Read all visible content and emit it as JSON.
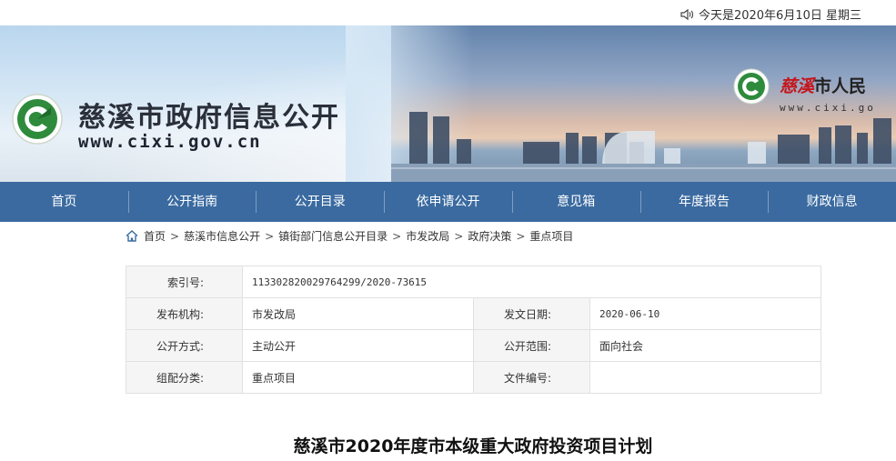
{
  "top": {
    "date_text": "今天是2020年6月10日 星期三"
  },
  "banner": {
    "site_title": "慈溪市政府信息公开",
    "site_url": "www.cixi.gov.cn",
    "right_title_red": "慈溪",
    "right_title_black": "市人民",
    "right_url": "www.cixi.go"
  },
  "nav": [
    "首页",
    "公开指南",
    "公开目录",
    "依申请公开",
    "意见箱",
    "年度报告",
    "财政信息"
  ],
  "breadcrumb": [
    "首页",
    "慈溪市信息公开",
    "镇街部门信息公开目录",
    "市发改局",
    "政府决策",
    "重点项目"
  ],
  "info": {
    "index_label": "索引号:",
    "index_value": "113302820029764299/2020-73615",
    "org_label": "发布机构:",
    "org_value": "市发改局",
    "date_label": "发文日期:",
    "date_value": "2020-06-10",
    "mode_label": "公开方式:",
    "mode_value": "主动公开",
    "scope_label": "公开范围:",
    "scope_value": "面向社会",
    "category_label": "组配分类:",
    "category_value": "重点项目",
    "docno_label": "文件编号:",
    "docno_value": ""
  },
  "doc_title": "慈溪市2020年度市本级重大政府投资项目计划",
  "colors": {
    "nav_bg": "#3a6aa0",
    "logo_green": "#2e8b3c",
    "accent_red": "#c4171d"
  }
}
